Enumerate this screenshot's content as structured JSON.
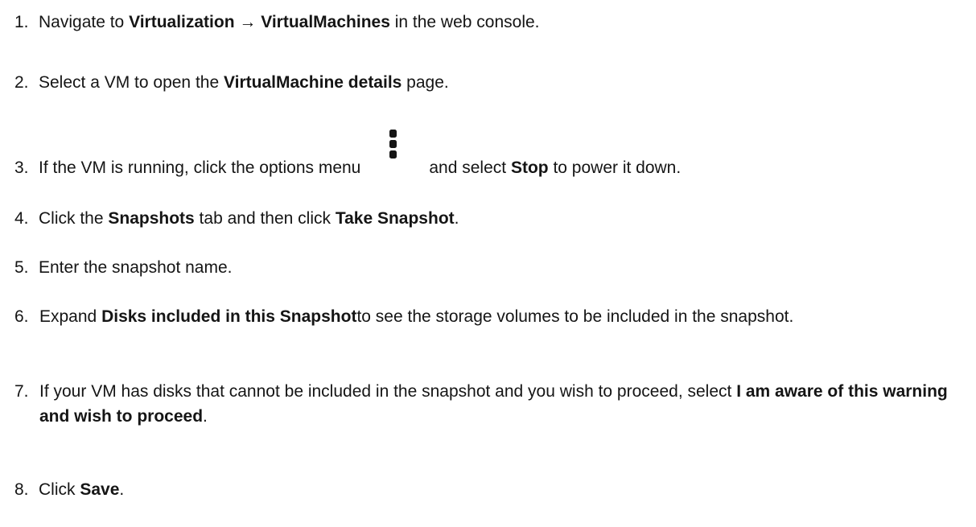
{
  "steps": [
    {
      "num": "1.",
      "parts": [
        "Navigate to ",
        "Virtualization → VirtualMachines",
        " in the web console."
      ]
    },
    {
      "num": "2.",
      "parts": [
        "Select a VM to open the ",
        "VirtualMachine details",
        " page."
      ]
    },
    {
      "num": "3.",
      "parts": [
        "If the VM is running, click the options menu",
        "and select ",
        "Stop",
        " to power it down."
      ],
      "icon": "kebab-options-icon"
    },
    {
      "num": "4.",
      "parts": [
        "Click the ",
        "Snapshots",
        " tab and then click ",
        "Take Snapshot",
        "."
      ]
    },
    {
      "num": "5.",
      "parts": [
        "Enter the snapshot name."
      ]
    },
    {
      "num": "6.",
      "parts": [
        "Expand ",
        "Disks included in this Snapshot",
        "to see the storage volumes to be included in the snapshot."
      ]
    },
    {
      "num": "7.",
      "parts": [
        "If your VM has disks that cannot be included in the snapshot and you wish to proceed, select ",
        "I am aware of this warning and wish to proceed",
        "."
      ]
    },
    {
      "num": "8.",
      "parts": [
        "Click ",
        "Save",
        "."
      ]
    }
  ]
}
